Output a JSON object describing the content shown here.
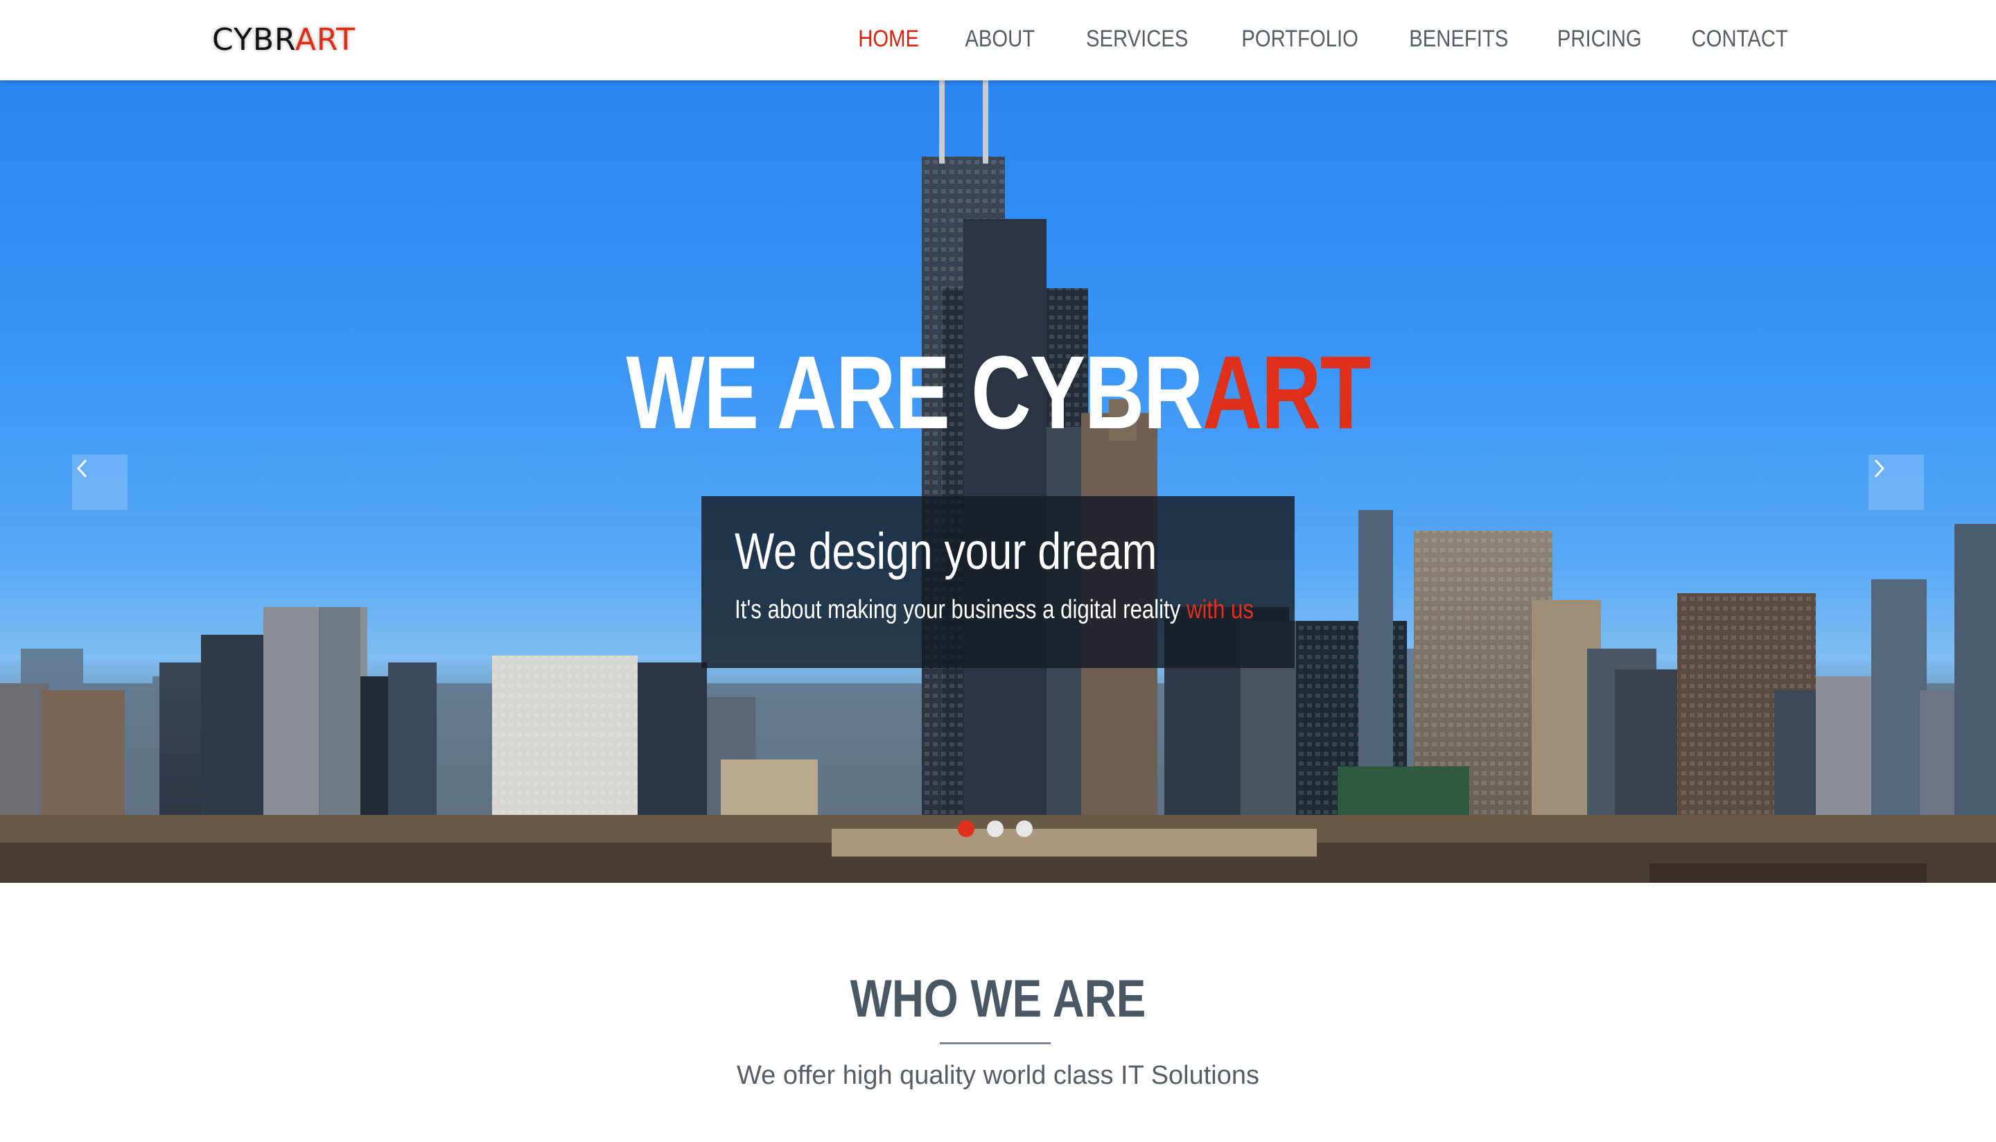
{
  "brand": {
    "logo_main": "CYBR",
    "logo_accent": "ART",
    "accent_color": "#e32a13"
  },
  "nav": {
    "items": [
      {
        "label": "HOME",
        "active": true
      },
      {
        "label": "ABOUT",
        "active": false
      },
      {
        "label": "SERVICES",
        "active": false
      },
      {
        "label": "PORTFOLIO",
        "active": false
      },
      {
        "label": "BENEFITS",
        "active": false
      },
      {
        "label": "PRICING",
        "active": false
      },
      {
        "label": "CONTACT",
        "active": false
      }
    ]
  },
  "hero": {
    "title_main": "WE ARE CYBR",
    "title_accent": "ART",
    "caption_title": "We design your dream",
    "caption_sub": "It's about making your business a digital reality ",
    "caption_sub_accent": "with us",
    "prev_icon": "chevron-left-icon",
    "next_icon": "chevron-right-icon",
    "slides": 3,
    "active_slide": 1
  },
  "about": {
    "title": "WHO WE ARE",
    "subtitle": "We offer high quality world class IT Solutions"
  }
}
